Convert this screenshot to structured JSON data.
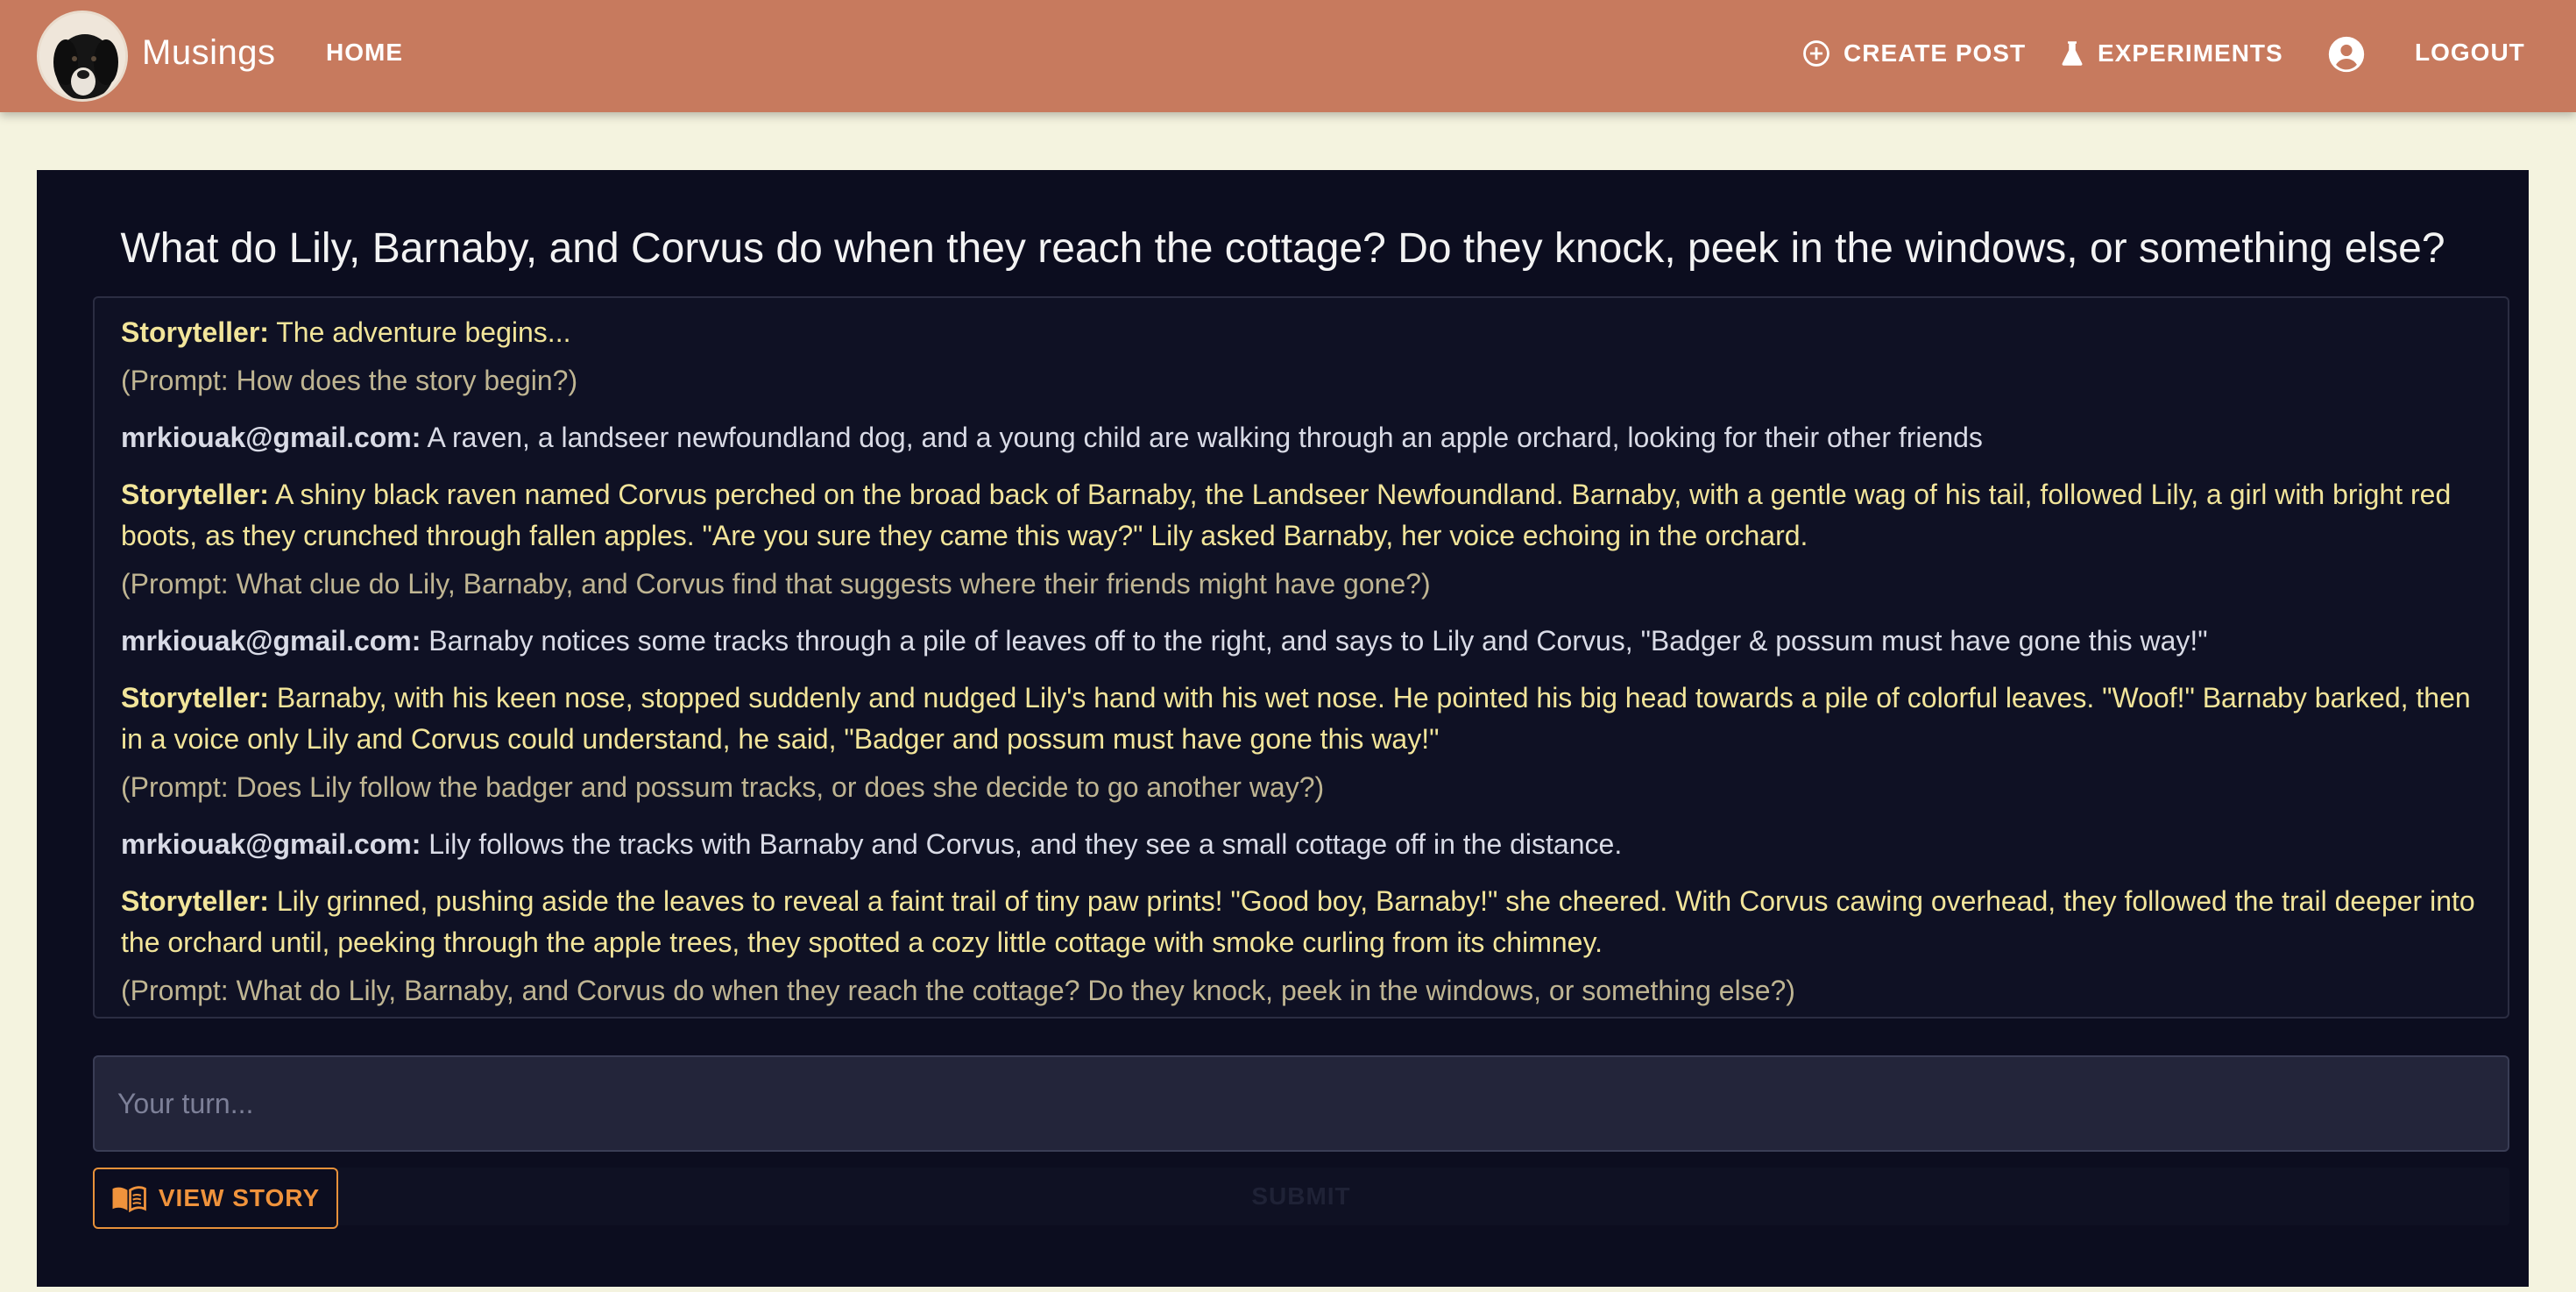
{
  "header": {
    "brand": "Musings",
    "nav_home": "HOME",
    "create_post": "CREATE POST",
    "experiments": "EXPERIMENTS",
    "logout": "LOGOUT"
  },
  "story": {
    "question": "What do Lily, Barnaby, and Corvus do when they reach the cottage? Do they knock, peek in the windows, or something else?",
    "entries": [
      {
        "speaker": "Storyteller:",
        "text": "The adventure begins...",
        "prompt": "(Prompt: How does the story begin?)"
      },
      {
        "speaker": "mrkiouak@gmail.com:",
        "text": "A raven, a landseer newfoundland dog, and a young child are walking through an apple orchard, looking for their other friends"
      },
      {
        "speaker": "Storyteller:",
        "text": "A shiny black raven named Corvus perched on the broad back of Barnaby, the Landseer Newfoundland. Barnaby, with a gentle wag of his tail, followed Lily, a girl with bright red boots, as they crunched through fallen apples. \"Are you sure they came this way?\" Lily asked Barnaby, her voice echoing in the orchard.",
        "prompt": "(Prompt: What clue do Lily, Barnaby, and Corvus find that suggests where their friends might have gone?)"
      },
      {
        "speaker": "mrkiouak@gmail.com:",
        "text": "Barnaby notices some tracks through a pile of leaves off to the right, and says to Lily and Corvus, \"Badger & possum must have gone this way!\""
      },
      {
        "speaker": "Storyteller:",
        "text": "Barnaby, with his keen nose, stopped suddenly and nudged Lily's hand with his wet nose. He pointed his big head towards a pile of colorful leaves. \"Woof!\" Barnaby barked, then in a voice only Lily and Corvus could understand, he said, \"Badger and possum must have gone this way!\"",
        "prompt": "(Prompt: Does Lily follow the badger and possum tracks, or does she decide to go another way?)"
      },
      {
        "speaker": "mrkiouak@gmail.com:",
        "text": "Lily follows the tracks with Barnaby and Corvus, and they see a small cottage off in the distance."
      },
      {
        "speaker": "Storyteller:",
        "text": "Lily grinned, pushing aside the leaves to reveal a faint trail of tiny paw prints! \"Good boy, Barnaby!\" she cheered. With Corvus cawing overhead, they followed the trail deeper into the orchard until, peeking through the apple trees, they spotted a cozy little cottage with smoke curling from its chimney.",
        "prompt": "(Prompt: What do Lily, Barnaby, and Corvus do when they reach the cottage? Do they knock, peek in the windows, or something else?)"
      }
    ],
    "input_placeholder": "Your turn...",
    "submit_label": "SUBMIT",
    "view_story": "VIEW STORY"
  },
  "colors": {
    "appbar": "#c77a5e",
    "background": "#f4f3df",
    "panel": "#0c0d1f",
    "storyteller_text": "#f2e59a",
    "accent": "#f0933c"
  },
  "icons": {
    "create_post": "add-circle-icon",
    "experiments": "flask-icon",
    "account": "account-circle-icon",
    "view_story": "book-icon"
  }
}
